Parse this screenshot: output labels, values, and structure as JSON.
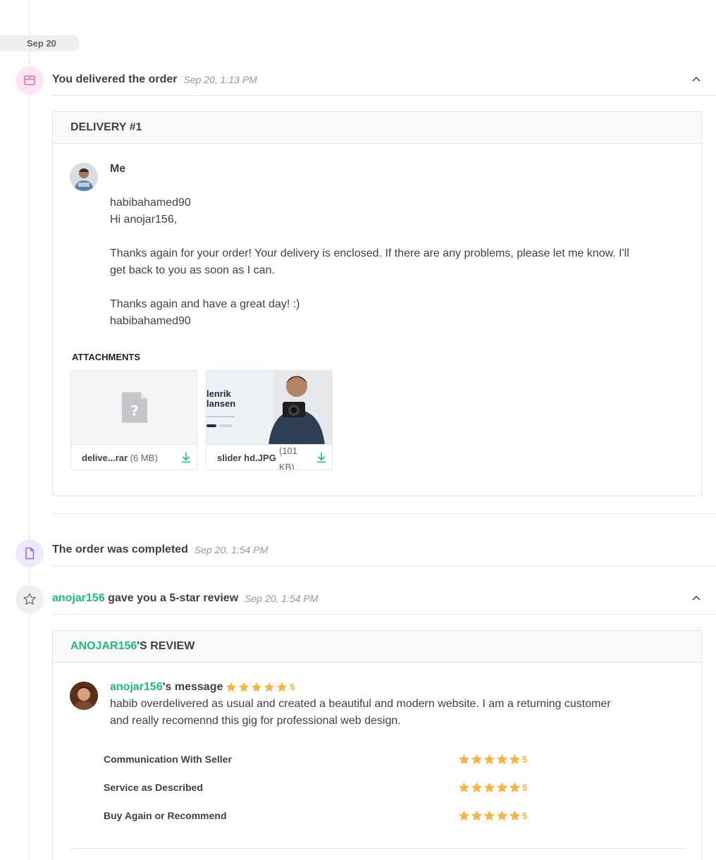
{
  "date_separator": "Sep 20",
  "colors": {
    "green": "#1dbf73",
    "star": "#ffb33e",
    "delivered_icon_bg": "#fde6f2",
    "completed_icon_bg": "#eeeafb",
    "review_icon_bg": "#efeff0"
  },
  "events": [
    {
      "icon": "package-icon",
      "title": "You delivered the order",
      "time": "Sep 20, 1:13 PM"
    },
    {
      "icon": "document-icon",
      "title": "The order was completed",
      "time": "Sep 20, 1:54 PM"
    },
    {
      "icon": "star-outline-icon",
      "user": "anojar156",
      "title_suffix": " gave you a 5-star review",
      "time": "Sep 20, 1:54 PM"
    }
  ],
  "delivery": {
    "header": "DELIVERY #1",
    "sender": "Me",
    "message_lines": [
      "habibahamed90",
      "Hi anojar156,",
      "",
      "Thanks again for your order! Your delivery is enclosed. If there are any problems, please let me know. I'll",
      "get back to you as soon as I can.",
      "",
      "Thanks again and have a great day! :)",
      "habibahamed90"
    ],
    "attachments_label": "ATTACHMENTS",
    "attachments": [
      {
        "name": "delive...rar",
        "size": "(6 MB)",
        "icon": "unknown-file-icon"
      },
      {
        "name": "slider hd.JPG",
        "size_line1": "(101",
        "size_line2": "KB)",
        "thumb_text_1": "lenrik",
        "thumb_text_2": "lansen"
      }
    ]
  },
  "review": {
    "header_user": "ANOJAR156",
    "header_suffix": "'S REVIEW",
    "user": "anojar156",
    "message_suffix": "'s message",
    "rating": "5",
    "text_line1": "habib overdelivered as usual and created a beautiful and modern website. I am a returning customer",
    "text_line2": "and really recomennd this gig for professional web design.",
    "criteria": [
      {
        "label": "Communication With Seller",
        "score": "5"
      },
      {
        "label": "Service as Described",
        "score": "5"
      },
      {
        "label": "Buy Again or Recommend",
        "score": "5"
      }
    ]
  }
}
